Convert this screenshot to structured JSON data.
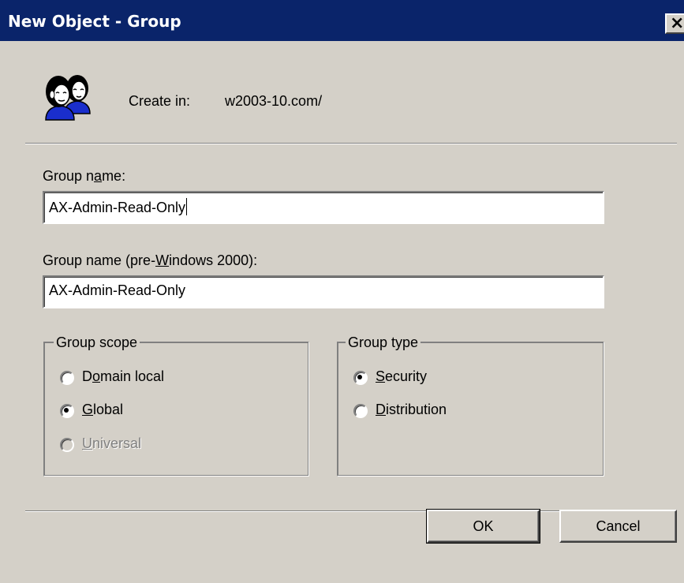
{
  "window": {
    "title": "New Object - Group",
    "close_glyph": "×"
  },
  "header": {
    "icon": "group-users-icon",
    "create_in_label": "Create in:",
    "create_in_path": "w2003-10.com/"
  },
  "form": {
    "group_name": {
      "label_pre": "Group n",
      "label_mnemonic": "a",
      "label_post": "me:",
      "value": "AX-Admin-Read-Only"
    },
    "group_name_pre2000": {
      "label_pre": "Group name (pre-",
      "label_mnemonic": "W",
      "label_post": "indows 2000):",
      "value": "AX-Admin-Read-Only"
    }
  },
  "group_scope": {
    "legend": "Group scope",
    "options": [
      {
        "pre": "D",
        "mnemonic": "o",
        "post": "main local",
        "selected": false,
        "disabled": false
      },
      {
        "pre": "",
        "mnemonic": "G",
        "post": "lobal",
        "selected": true,
        "disabled": false
      },
      {
        "pre": "",
        "mnemonic": "U",
        "post": "niversal",
        "selected": false,
        "disabled": true
      }
    ]
  },
  "group_type": {
    "legend": "Group type",
    "options": [
      {
        "pre": "",
        "mnemonic": "S",
        "post": "ecurity",
        "selected": true,
        "disabled": false
      },
      {
        "pre": "",
        "mnemonic": "D",
        "post": "istribution",
        "selected": false,
        "disabled": false
      }
    ]
  },
  "buttons": {
    "ok": "OK",
    "cancel": "Cancel"
  },
  "colors": {
    "titlebar": "#0a246a",
    "face": "#d4d0c8",
    "disabled_text": "#808080"
  }
}
